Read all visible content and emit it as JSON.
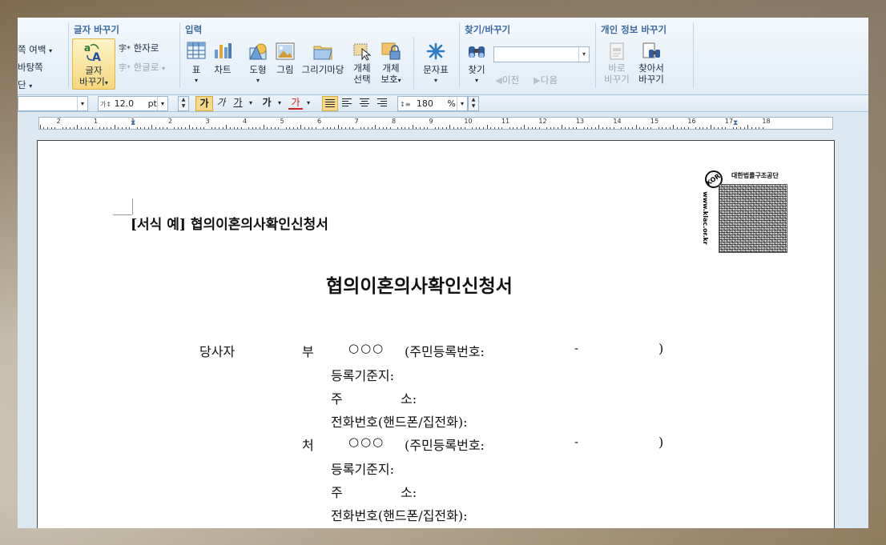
{
  "ribbon": {
    "left_partial": {
      "margin_label": "쪽 여백",
      "bg_label": "바탕쪽",
      "col_label": "단"
    },
    "text_change": {
      "title": "글자 바꾸기",
      "change_label_1": "글자",
      "change_label_2": "바꾸기",
      "hanja_label": "한자로",
      "hangul_label": "한글로"
    },
    "input": {
      "title": "입력",
      "table_label": "표",
      "chart_label": "차트",
      "shape_label": "도형",
      "picture_label": "그림",
      "draw_label": "그리기마당",
      "select_label_1": "개체",
      "select_label_2": "선택",
      "protect_label_1": "개체",
      "protect_label_2": "보호",
      "charmap_label": "문자표"
    },
    "find": {
      "title": "찾기/바꾸기",
      "find_label": "찾기",
      "prev_label": "이전",
      "next_label": "다음",
      "search_value": ""
    },
    "privacy": {
      "title": "개인 정보 바꾸기",
      "direct_label_1": "바로",
      "direct_label_2": "바꾸기",
      "findrep_label_1": "찾아서",
      "findrep_label_2": "바꾸기"
    }
  },
  "format_bar": {
    "font_size": "12.0",
    "font_unit": "pt",
    "bold_glyph": "가",
    "italic_glyph": "가",
    "underline_glyph": "가",
    "strike_glyph": "가",
    "color_glyph": "가",
    "line_spacing": "180",
    "line_unit": "%"
  },
  "ruler": {
    "numbers": [
      "2",
      "1",
      "1",
      "2",
      "3",
      "4",
      "5",
      "6",
      "7",
      "8",
      "9",
      "10",
      "11",
      "12",
      "13",
      "14",
      "15",
      "16",
      "17",
      "18"
    ]
  },
  "document": {
    "form_label": "[서식  예]  협의이혼의사확인신청서",
    "title": "협의이혼의사확인신청서",
    "party_label": "당사자",
    "husband": "부",
    "wife": "처",
    "name_mark": "○○○",
    "id_label": "(주민등록번호:",
    "id_dash": "-",
    "id_close": ")",
    "registry_label": "등록기준지:",
    "address_label_1": "주",
    "address_label_2": "소:",
    "phone_label": "전화번호(핸드폰/집전화):"
  },
  "stamp": {
    "org_name": "대한법률구조공단",
    "site": "www.klac.or.kr",
    "badge": "KOR"
  },
  "colors": {
    "ribbon_title": "#3a6aa0",
    "page_bg": "#ffffff",
    "workspace_bg": "#dce8f2"
  }
}
